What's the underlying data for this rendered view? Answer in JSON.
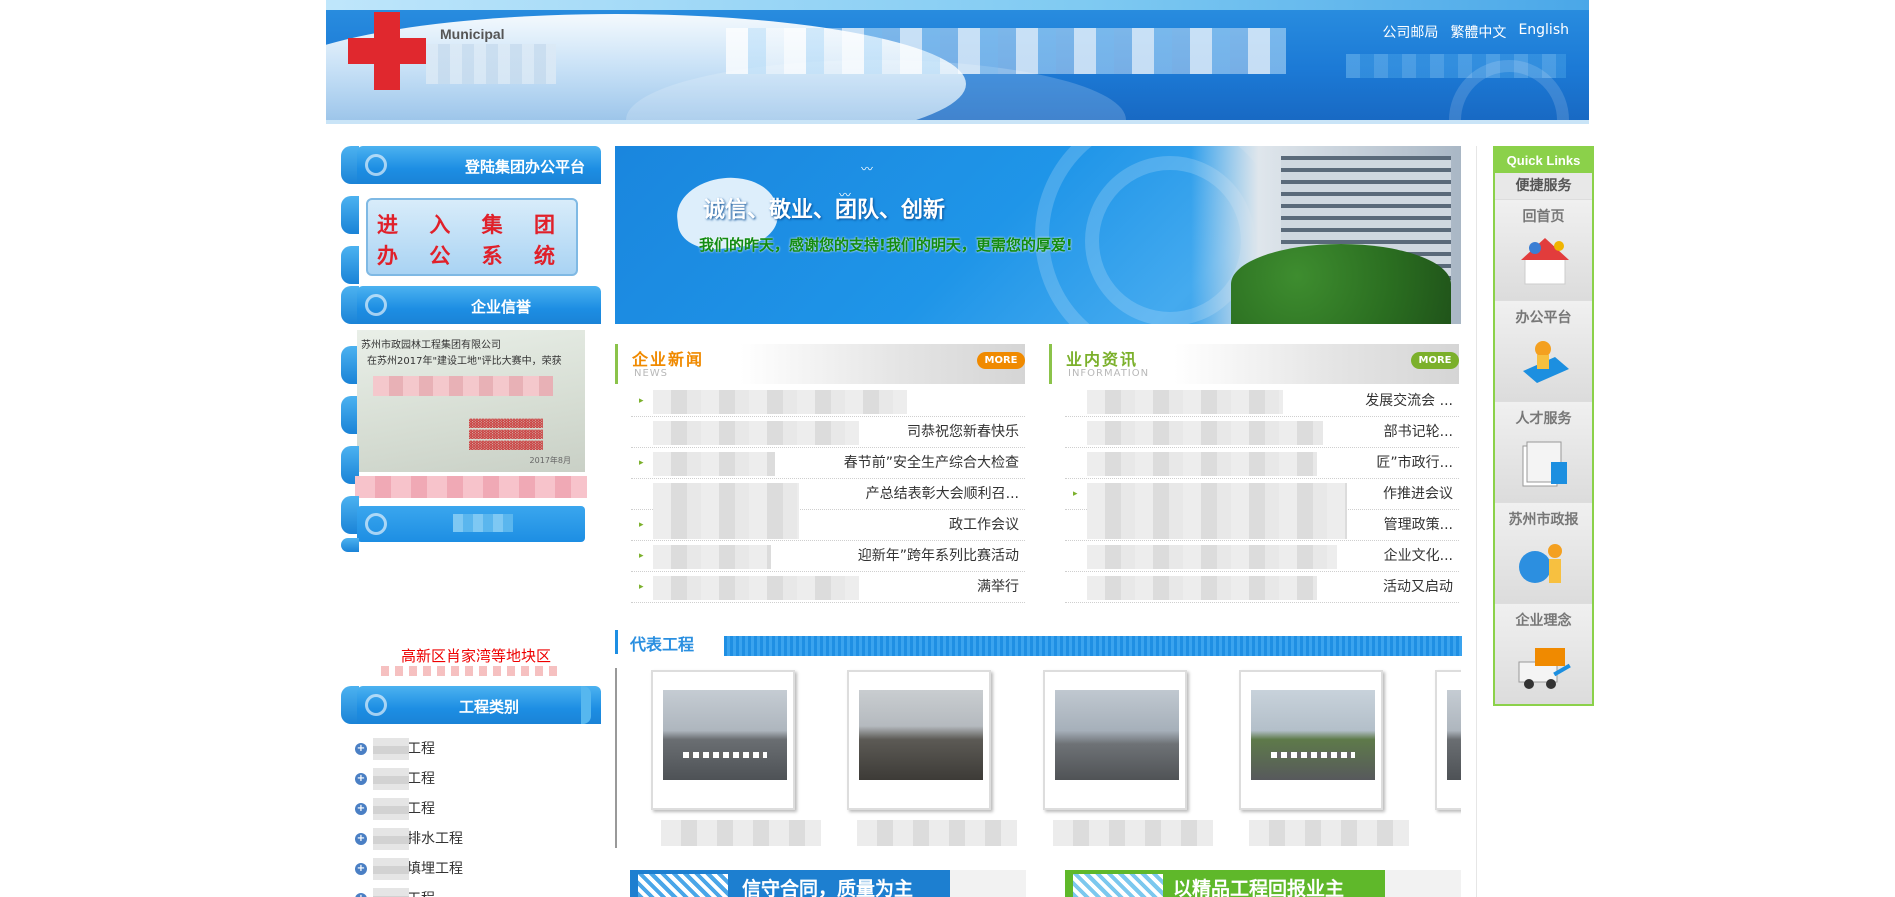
{
  "header": {
    "logo_text": "Municipal",
    "top_links": [
      "公司邮局",
      "繁體中文",
      "English"
    ]
  },
  "sidebar": {
    "login_title": "登陆集团办公平台",
    "login_button_lines": [
      "进 入 集 团",
      "办 公 系 统"
    ],
    "credit_title": "企业信誉",
    "certificate_line1": "苏州市政园林工程集团有限公司",
    "certificate_line2": "在苏州2017年\"建设工地\"评比大赛中，荣获",
    "certificate_date": "2017年8月",
    "scroll_text": "高新区肖家湾等地块区",
    "category_title": "工程类别",
    "categories": [
      "工程",
      "工程",
      "工程",
      "排水工程",
      "填埋工程",
      "工程"
    ]
  },
  "banner": {
    "slogan": "诚信、敬业、团队、创新",
    "subline": "我们的昨天，感谢您的支持!我们的明天，更需您的厚爱!"
  },
  "news": {
    "title": "企业新闻",
    "subtitle": "NEWS",
    "more": "MORE",
    "items": [
      "",
      "司恭祝您新春快乐",
      "春节前”安全生产综合大检查",
      "产总结表彰大会顺利召...",
      "政工作会议",
      "迎新年”跨年系列比赛活动",
      "满举行"
    ]
  },
  "industry": {
    "title": "业内资讯",
    "subtitle": "INFORMATION",
    "more": "MORE",
    "items": [
      "发展交流会   ...",
      "部书记轮...",
      "匠”市政行...",
      "作推进会议",
      "管理政策...",
      "企业文化...",
      "活动又启动"
    ]
  },
  "projects": {
    "title": "代表工程",
    "count": 4
  },
  "promos": [
    {
      "text": "信守合同，质量为主",
      "color": "#1d7fd0"
    },
    {
      "text": "以精品工程回报业主",
      "color": "#5fb82a"
    }
  ],
  "quick_links": {
    "title": "Quick Links",
    "subtitle": "便捷服务",
    "items": [
      {
        "label": "回首页",
        "icon": "home-icon"
      },
      {
        "label": "办公平台",
        "icon": "office-icon"
      },
      {
        "label": "人才服务",
        "icon": "talent-icon"
      },
      {
        "label": "苏州市政报",
        "icon": "news-icon"
      },
      {
        "label": "企业理念",
        "icon": "philosophy-icon"
      }
    ]
  },
  "colors": {
    "brand_blue": "#1d8ee3",
    "accent_green": "#8bd14a",
    "news_orange": "#f08a00"
  }
}
